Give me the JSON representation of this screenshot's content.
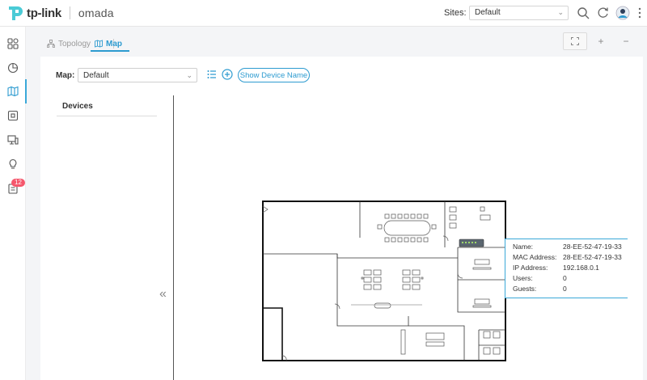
{
  "header": {
    "brand": "tp-link",
    "product": "omada",
    "sites_label": "Sites:",
    "site_value": "Default"
  },
  "rail": {
    "badge_count": "12"
  },
  "tabs": [
    {
      "label": "Topology"
    },
    {
      "label": "Map"
    }
  ],
  "toolbar": {
    "zoom_in": "+",
    "zoom_out": "−"
  },
  "map_controls": {
    "map_label": "Map:",
    "map_value": "Default",
    "show_device_name": "Show Device Name"
  },
  "devices_panel": {
    "title": "Devices"
  },
  "tooltip": {
    "rows": [
      {
        "key": "Name:",
        "value": "28-EE-52-47-19-33"
      },
      {
        "key": "MAC Address:",
        "value": "28-EE-52-47-19-33"
      },
      {
        "key": "IP Address:",
        "value": "192.168.0.1"
      },
      {
        "key": "Users:",
        "value": "0"
      },
      {
        "key": "Guests:",
        "value": "0"
      }
    ]
  },
  "colors": {
    "accent": "#2d9bd0",
    "badge": "#f5576c"
  }
}
